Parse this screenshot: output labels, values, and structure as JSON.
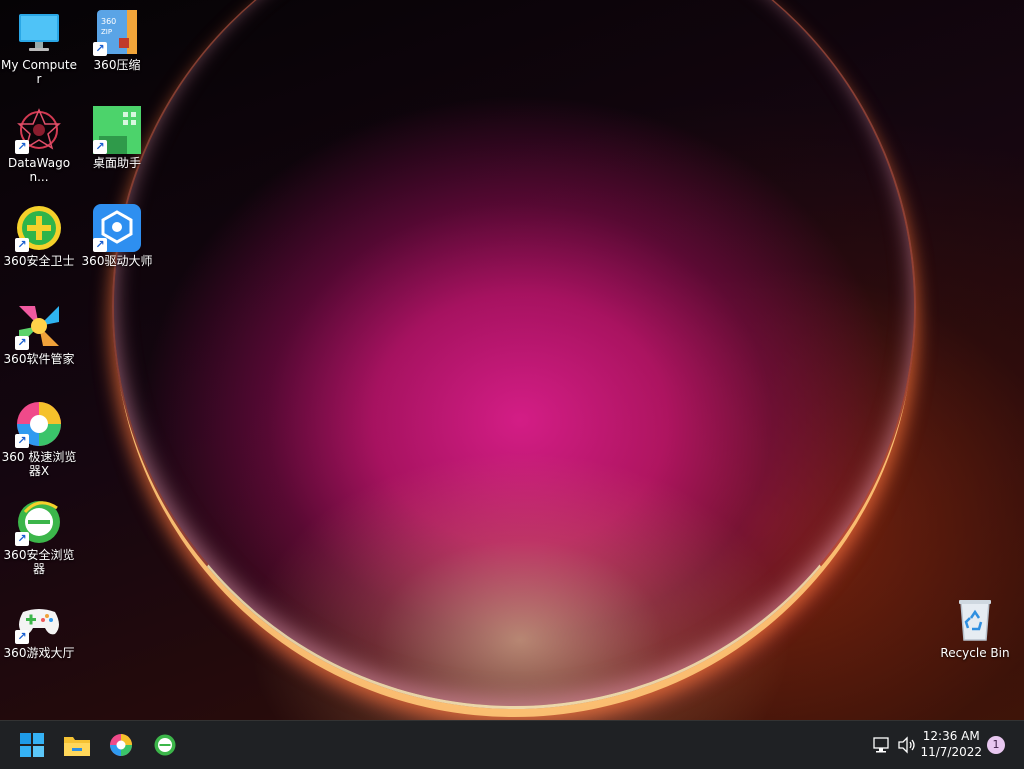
{
  "desktop_icons": [
    {
      "label": "My Computer",
      "icon": "monitor-icon"
    },
    {
      "label": "360压缩",
      "icon": "zip-archive-icon"
    },
    {
      "label": "DataWagon...",
      "icon": "datawagon-icon"
    },
    {
      "label": "桌面助手",
      "icon": "desktop-helper-icon"
    },
    {
      "label": "360安全卫士",
      "icon": "360-safe-guard-icon"
    },
    {
      "label": "360驱动大师",
      "icon": "360-driver-master-icon"
    },
    {
      "label": "360软件管家",
      "icon": "360-software-manager-icon"
    },
    {
      "label": "360 极速浏览器X",
      "icon": "360-speed-browser-icon"
    },
    {
      "label": "360安全浏览器",
      "icon": "360-safe-browser-icon"
    },
    {
      "label": "360游戏大厅",
      "icon": "360-game-hall-icon"
    },
    {
      "label": "Recycle Bin",
      "icon": "recycle-bin-icon"
    }
  ],
  "taskbar": {
    "pinned": [
      "start-icon",
      "file-explorer-icon",
      "360-speed-browser-icon",
      "360-safe-browser-icon"
    ],
    "clock": {
      "time": "12:36 AM",
      "date": "11/7/2022"
    },
    "notification_count": "1"
  },
  "colors": {
    "taskbar_bg": "#1f2124",
    "accent_blue": "#1e9be8",
    "label_text": "#ffffff"
  }
}
